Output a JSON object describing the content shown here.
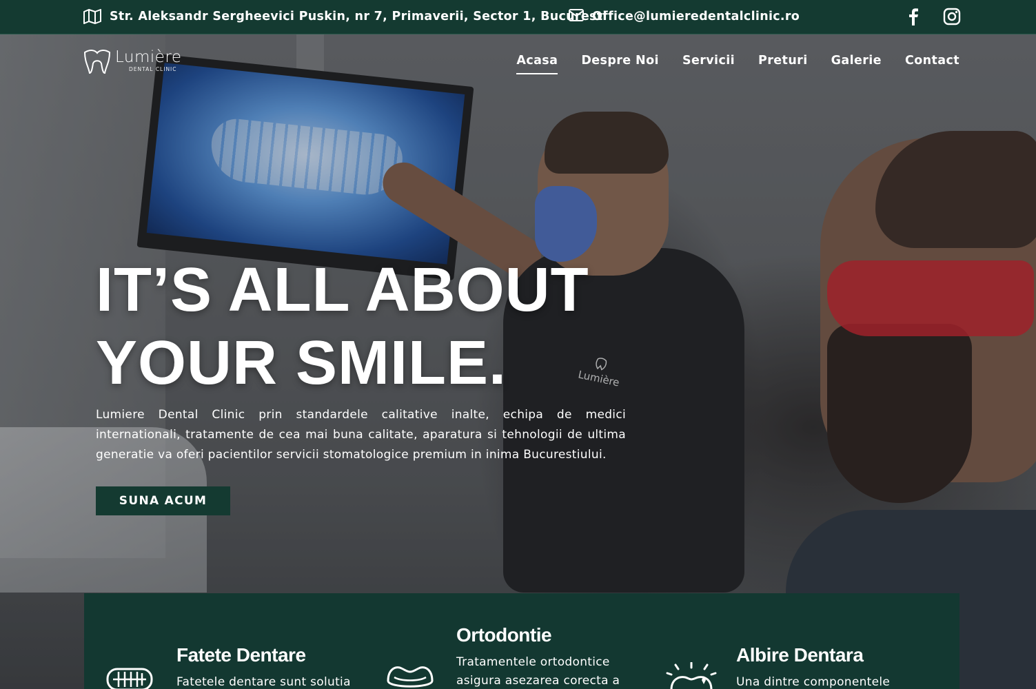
{
  "topbar": {
    "address": "Str. Aleksandr Sergheevici Puskin, nr 7, Primaverii, Sector 1, Bucuresti",
    "email": "Office@lumieredentalclinic.ro",
    "address_icon": "map-icon",
    "email_icon": "envelope-icon",
    "social": [
      "facebook-icon",
      "instagram-icon"
    ]
  },
  "brand": {
    "name": "Lumière",
    "subtitle": "DENTAL CLINIC"
  },
  "nav": {
    "items": [
      {
        "label": "Acasa",
        "active": true
      },
      {
        "label": "Despre Noi"
      },
      {
        "label": "Servicii"
      },
      {
        "label": "Preturi"
      },
      {
        "label": "Galerie"
      },
      {
        "label": "Contact"
      }
    ]
  },
  "hero": {
    "headline_line1": "IT’S ALL ABOUT",
    "headline_line2": "YOUR SMILE.",
    "intro": "Lumiere Dental Clinic prin standardele calitative inalte, echipa de medici internationali, tratamente de cea mai buna calitate, aparatura si tehnologii de ultima generatie va oferi pacientilor servicii stomatologice premium in inima Bucurestiului.",
    "cta": "SUNA ACUM",
    "shirt_logo": "Lumière"
  },
  "services": [
    {
      "title": "Fatete Dentare",
      "desc": "Fatetele dentare sunt solutia",
      "icon": "teeth-icon"
    },
    {
      "title": "Ortodontie",
      "desc": "Tratamentele ortodontice asigura asezarea corecta a",
      "icon": "aligner-icon"
    },
    {
      "title": "Albire Dentara",
      "desc": "Una dintre componentele cele",
      "icon": "whitening-icon"
    }
  ],
  "colors": {
    "primary_green": "#143a31",
    "text": "#ffffff"
  }
}
